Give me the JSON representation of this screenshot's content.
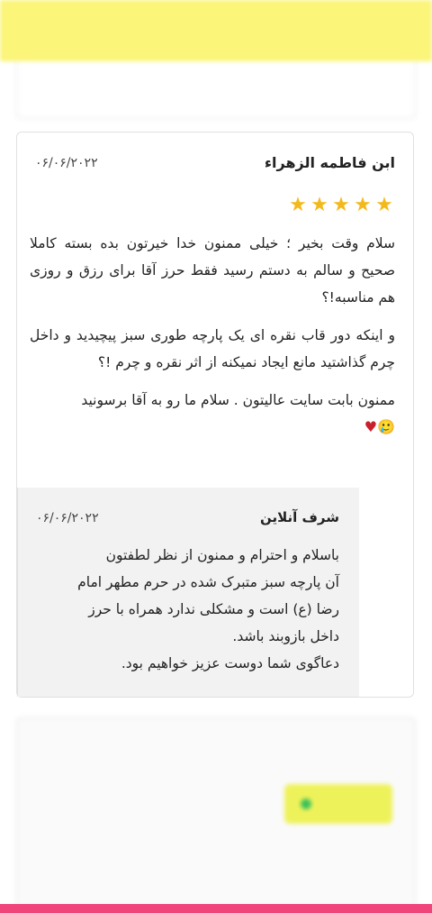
{
  "review": {
    "author": "ابن فاطمه الزهراء",
    "date": "۰۶/۰۶/۲۰۲۲",
    "rating": 5,
    "stars": [
      "★",
      "★",
      "★",
      "★",
      "★"
    ],
    "paragraphs": [
      "سلام وقت بخیر ؛ خیلی ممنون خدا خیرتون بده بسته کاملا صحیح و سالم به دستم رسید فقط حرز آقا برای رزق و روزی هم مناسبه!؟",
      "و اینکه دور قاب نقره ای یک پارچه طوری سبز پیچیدید و داخل چرم گذاشتید مانع ایجاد نمیکنه از اثر نقره و چرم !؟",
      "ممنون بابت سایت عالیتون . سلام ما رو به آقا برسونید"
    ],
    "emoji_face": "🥲",
    "emoji_heart": "♥"
  },
  "reply": {
    "author": "شرف آنلاین",
    "date": "۰۶/۰۶/۲۰۲۲",
    "lines": [
      "باسلام و احترام و ممنون از نظر لطفتون",
      "آن پارچه سبز متبرک شده در حرم مطهر امام",
      "رضا (ع) است و مشکلی ندارد همراه با حرز",
      "داخل بازوبند باشد.",
      "دعاگوی شما دوست عزیز خواهیم بود."
    ]
  },
  "watermark": "شرف آنلاین",
  "colors": {
    "star": "#f3b91c",
    "reply_bg": "#f2f2f2",
    "banner": "#fbf57a",
    "bottom_bar": "#f0457a"
  }
}
